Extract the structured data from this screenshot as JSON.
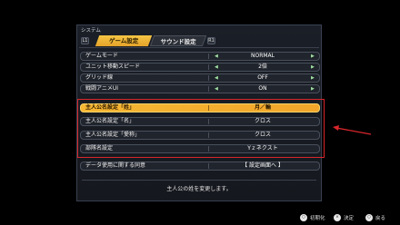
{
  "panel": {
    "title": "システム"
  },
  "tabs": {
    "left_bumper": "L1",
    "right_bumper": "R1",
    "items": [
      {
        "label": "ゲーム設定",
        "active": true
      },
      {
        "label": "サウンド設定",
        "active": false
      }
    ]
  },
  "settings": [
    {
      "label": "ゲームモード",
      "value": "NORMAL",
      "arrows": true
    },
    {
      "label": "ユニット移動スピード",
      "value": "2倍",
      "arrows": true
    },
    {
      "label": "グリッド線",
      "value": "OFF",
      "arrows": true
    },
    {
      "label": "戦闘アニメUI",
      "value": "ON",
      "arrows": true
    },
    {
      "label": "主人公名設定「姓」",
      "value": "月／輪",
      "selected": true
    },
    {
      "label": "主人公名設定「名」",
      "value": "クロス"
    },
    {
      "label": "主人公名設定「愛称」",
      "value": "クロス"
    },
    {
      "label": "部隊名設定",
      "value": "Yｚネクスト"
    },
    {
      "label": "データ使用に関する同意",
      "value": "【 設定画面へ 】"
    }
  ],
  "description": "主人公の姓を変更します。",
  "footer": [
    {
      "icon": "○",
      "label": "初期化"
    },
    {
      "icon": "×",
      "label": "決定"
    },
    {
      "icon": "○",
      "label": "戻る"
    }
  ],
  "colors": {
    "accent": "#f5c544",
    "highlight_box": "#d8262b",
    "background": "#000000"
  }
}
